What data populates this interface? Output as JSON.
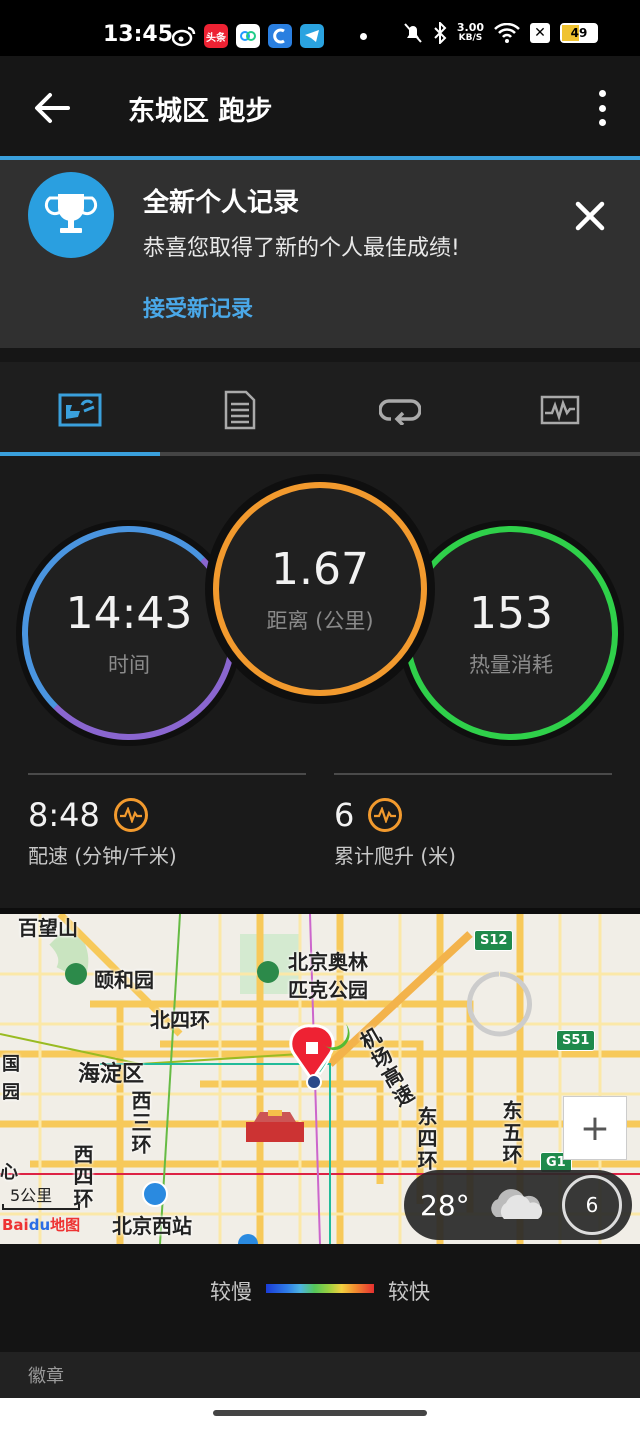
{
  "status_bar": {
    "time": "13:45",
    "net_speed_value": "3.00",
    "net_speed_unit": "KB/S",
    "battery": "49",
    "apps": [
      "weibo-icon",
      "toutiao-icon",
      "app-icon",
      "app-icon",
      "telegram-icon"
    ],
    "app_toutiao_text": "头条"
  },
  "header": {
    "title": "东城区 跑步"
  },
  "record_banner": {
    "title": "全新个人记录",
    "subtitle": "恭喜您取得了新的个人最佳成绩!",
    "link": "接受新记录"
  },
  "tabs": [
    {
      "icon": "stats-icon",
      "active": true
    },
    {
      "icon": "details-icon",
      "active": false
    },
    {
      "icon": "laps-icon",
      "active": false
    },
    {
      "icon": "chart-icon",
      "active": false
    }
  ],
  "stats": {
    "time": {
      "value": "14:43",
      "label": "时间"
    },
    "distance": {
      "value": "1.67",
      "label": "距离 (公里)"
    },
    "calories": {
      "value": "153",
      "label": "热量消耗"
    },
    "pace": {
      "value": "8:48",
      "label": "配速 (分钟/千米)"
    },
    "elevation": {
      "value": "6",
      "label": "累计爬升 (米)"
    }
  },
  "map": {
    "labels": {
      "baiwangshan": "百望山",
      "yiheyuan": "颐和园",
      "olympic": "北京奥林",
      "olympic2": "匹克公园",
      "beisihuan": "北四环",
      "haidian": "海淀区",
      "xisanhuan": "西三环",
      "xisihuan": "西四环",
      "beijingxi": "北京西站",
      "jichang": "机场高速",
      "dongsihuan": "东四环",
      "dongwuhuan": "东五环",
      "guo": "国",
      "yuan": "园",
      "xin": "心"
    },
    "badges": {
      "s12": "S12",
      "s51": "S51",
      "g1": "G1"
    },
    "scale": "5公里",
    "logo_a": "Bai",
    "logo_b": "du",
    "logo_c": "地图",
    "zoom_in": "+",
    "weather": {
      "temp": "28°",
      "uv": "6"
    }
  },
  "legend": {
    "slow": "较慢",
    "fast": "较快",
    "colors": [
      "#1a3cd8",
      "#2f7ee8",
      "#4db4e0",
      "#55c65a",
      "#9ad040",
      "#f2d040",
      "#f29030",
      "#e63030"
    ]
  },
  "badges_section": {
    "label": "徽章"
  },
  "colors": {
    "accent": "#3aa0dc",
    "time_ring": "#4a95e0",
    "distance_ring": "#f29a2e",
    "calorie_ring": "#2fd04a"
  }
}
